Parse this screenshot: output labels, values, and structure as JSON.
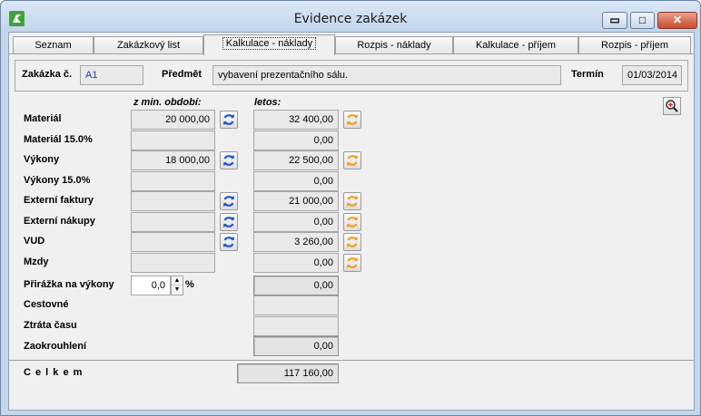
{
  "window": {
    "title": "Evidence zakázek",
    "min_label": "▭",
    "max_label": "□",
    "close_label": "✕"
  },
  "tabs": [
    {
      "label": "Seznam"
    },
    {
      "label": "Zakázkový list"
    },
    {
      "label": "Kalkulace - náklady"
    },
    {
      "label": "Rozpis - náklady"
    },
    {
      "label": "Kalkulace - příjem"
    },
    {
      "label": "Rozpis - příjem"
    }
  ],
  "header": {
    "order_label": "Zakázka č.",
    "order_value": "A1",
    "subject_label": "Předmět",
    "subject_value": "vybavení prezentačního sálu.",
    "term_label": "Termín",
    "term_value": "01/03/2014"
  },
  "columns": {
    "prev": "z min. období:",
    "current": "letos:"
  },
  "rows": [
    {
      "label": "Materiál",
      "prev": "20 000,00",
      "current": "32 400,00"
    },
    {
      "label": "Materiál 15.0%",
      "prev": "",
      "current": "0,00"
    },
    {
      "label": "Výkony",
      "prev": "18 000,00",
      "current": "22 500,00"
    },
    {
      "label": "Výkony 15.0%",
      "prev": "",
      "current": "0,00"
    },
    {
      "label": "Externí faktury",
      "prev": "",
      "current": "21 000,00"
    },
    {
      "label": "Externí nákupy",
      "prev": "",
      "current": "0,00"
    },
    {
      "label": "VUD",
      "prev": "",
      "current": "3 260,00"
    },
    {
      "label": "Mzdy",
      "prev": "",
      "current": "0,00"
    }
  ],
  "surcharge": {
    "label": "Přirážka na výkony",
    "value": "0,0",
    "unit": "%",
    "result": "0,00"
  },
  "extras": [
    {
      "label": "Cestovné",
      "value": ""
    },
    {
      "label": "Ztráta času",
      "value": ""
    },
    {
      "label": "Zaokrouhlení",
      "value": "0,00"
    }
  ],
  "total": {
    "label": "C e l k e m",
    "value": "117 160,00"
  },
  "colors": {
    "refresh_blue": "#1f57c8",
    "refresh_orange": "#f0a020",
    "accent_green": "#3fa33a"
  },
  "icons": {
    "app": "app-icon",
    "refresh_prev": "refresh-blue-icon",
    "refresh_current": "refresh-orange-icon",
    "zoom": "zoom-in-icon"
  }
}
